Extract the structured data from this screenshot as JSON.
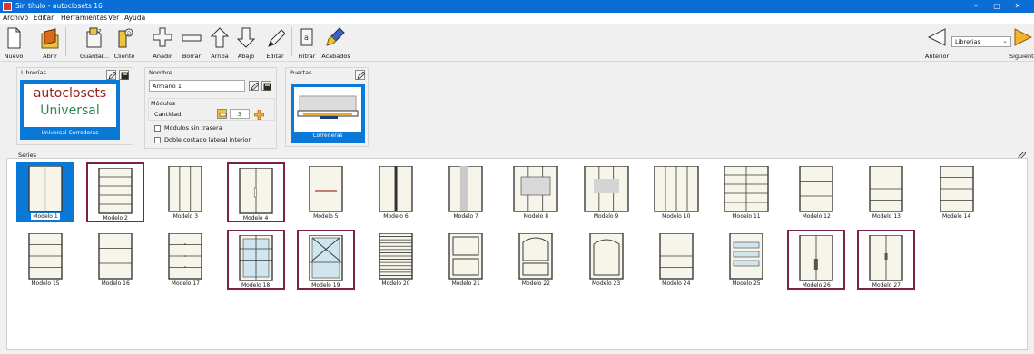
{
  "window": {
    "title": "Sin título - autoclosets 16",
    "min": "–",
    "max": "▢",
    "close": "✕"
  },
  "menu": [
    "Archivo",
    "Editar",
    "Herramientas",
    "Ver",
    "Ayuda"
  ],
  "toolbar": {
    "nuevo": "Nuevo",
    "abrir": "Abrir",
    "guardar": "Guardar...",
    "cliente": "Cliente",
    "anadir": "Añadir",
    "borrar": "Borrar",
    "arriba": "Arriba",
    "abajo": "Abajo",
    "editar": "Editar",
    "filtrar": "Filtrar",
    "acabados": "Acabados",
    "anterior": "Anterior",
    "siguiente": "Siguiente"
  },
  "library_select": {
    "value": "Librerias"
  },
  "librerias_panel": {
    "title": "Librerías",
    "logo_line1": "autoclosets",
    "logo_line2": "Universal",
    "caption": "Universal Correderas"
  },
  "nombre_panel": {
    "title": "Nombre",
    "value": "Armario 1",
    "modulos_title": "Módulos",
    "cantidad_label": "Cantidad",
    "cantidad_value": "3",
    "sin_trasera": "Módulos sin trasera",
    "doble_costado": "Doble costado lateral interior"
  },
  "puertas_panel": {
    "title": "Puertas",
    "caption": "Correderas"
  },
  "series": {
    "label": "Series",
    "models": [
      {
        "name": "Modelo 1",
        "state": "selected",
        "style": "plain2"
      },
      {
        "name": "Modelo 2",
        "state": "highlight",
        "style": "shelves"
      },
      {
        "name": "Modelo 3",
        "state": "",
        "style": "vsplit3"
      },
      {
        "name": "Modelo 4",
        "state": "highlight",
        "style": "twoDoorsHandle"
      },
      {
        "name": "Modelo 5",
        "state": "",
        "style": "midbar"
      },
      {
        "name": "Modelo 6",
        "state": "",
        "style": "darkCenter"
      },
      {
        "name": "Modelo 7",
        "state": "",
        "style": "greyCenter"
      },
      {
        "name": "Modelo 8",
        "state": "",
        "style": "wideWindow"
      },
      {
        "name": "Modelo 9",
        "state": "",
        "style": "wideGrey"
      },
      {
        "name": "Modelo 10",
        "state": "",
        "style": "wide3"
      },
      {
        "name": "Modelo 11",
        "state": "",
        "style": "wideGrid"
      },
      {
        "name": "Modelo 12",
        "state": "",
        "style": "h3"
      },
      {
        "name": "Modelo 13",
        "state": "",
        "style": "h3b"
      },
      {
        "name": "Modelo 14",
        "state": "",
        "style": "h4"
      },
      {
        "name": "Modelo 15",
        "state": "",
        "style": "h4"
      },
      {
        "name": "Modelo 16",
        "state": "",
        "style": "h3"
      },
      {
        "name": "Modelo 17",
        "state": "",
        "style": "h4dots"
      },
      {
        "name": "Modelo 18",
        "state": "highlight",
        "style": "glassGrid"
      },
      {
        "name": "Modelo 19",
        "state": "highlight",
        "style": "glassX"
      },
      {
        "name": "Modelo 20",
        "state": "",
        "style": "stripes"
      },
      {
        "name": "Modelo 21",
        "state": "",
        "style": "framed2"
      },
      {
        "name": "Modelo 22",
        "state": "",
        "style": "arched"
      },
      {
        "name": "Modelo 23",
        "state": "",
        "style": "arched2"
      },
      {
        "name": "Modelo 24",
        "state": "",
        "style": "h3b"
      },
      {
        "name": "Modelo 25",
        "state": "",
        "style": "glassBands"
      },
      {
        "name": "Modelo 26",
        "state": "highlight",
        "style": "twoDoorsDarkHandle"
      },
      {
        "name": "Modelo 27",
        "state": "highlight",
        "style": "twoDoorsSmallHandle"
      }
    ]
  }
}
